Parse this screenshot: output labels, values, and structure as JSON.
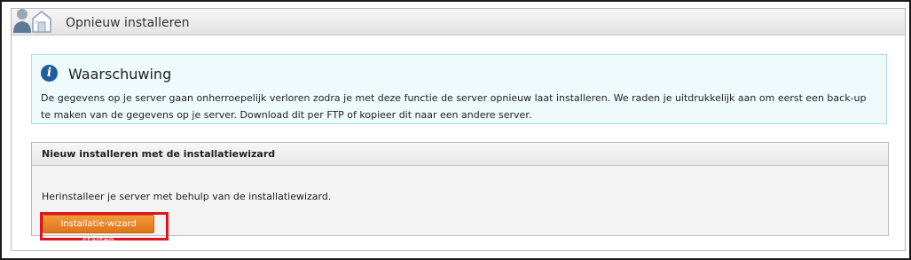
{
  "panel": {
    "title": "Opnieuw installeren",
    "logo_icon": "user-server-icon"
  },
  "warning": {
    "icon": "info-icon",
    "icon_glyph": "i",
    "title": "Waarschuwing",
    "text": "De gegevens op je server gaan onherroepelijk verloren zodra je met deze functie de server opnieuw laat installeren. We raden je uitdrukkelijk aan om eerst een back-up te maken van de gegevens op je server. Download dit per FTP of kopieer dit naar een andere server."
  },
  "wizard_section": {
    "title": "Nieuw installeren met de installatiewizard",
    "description": "Herinstalleer je server met behulp van de installatiewizard.",
    "button_label": "Installatie-wizard starten"
  },
  "colors": {
    "button": "#e8801f",
    "highlight": "#e0141e",
    "warning_bg": "#eefafc",
    "warning_border": "#a9dde4",
    "info_icon": "#1f5d9c"
  }
}
